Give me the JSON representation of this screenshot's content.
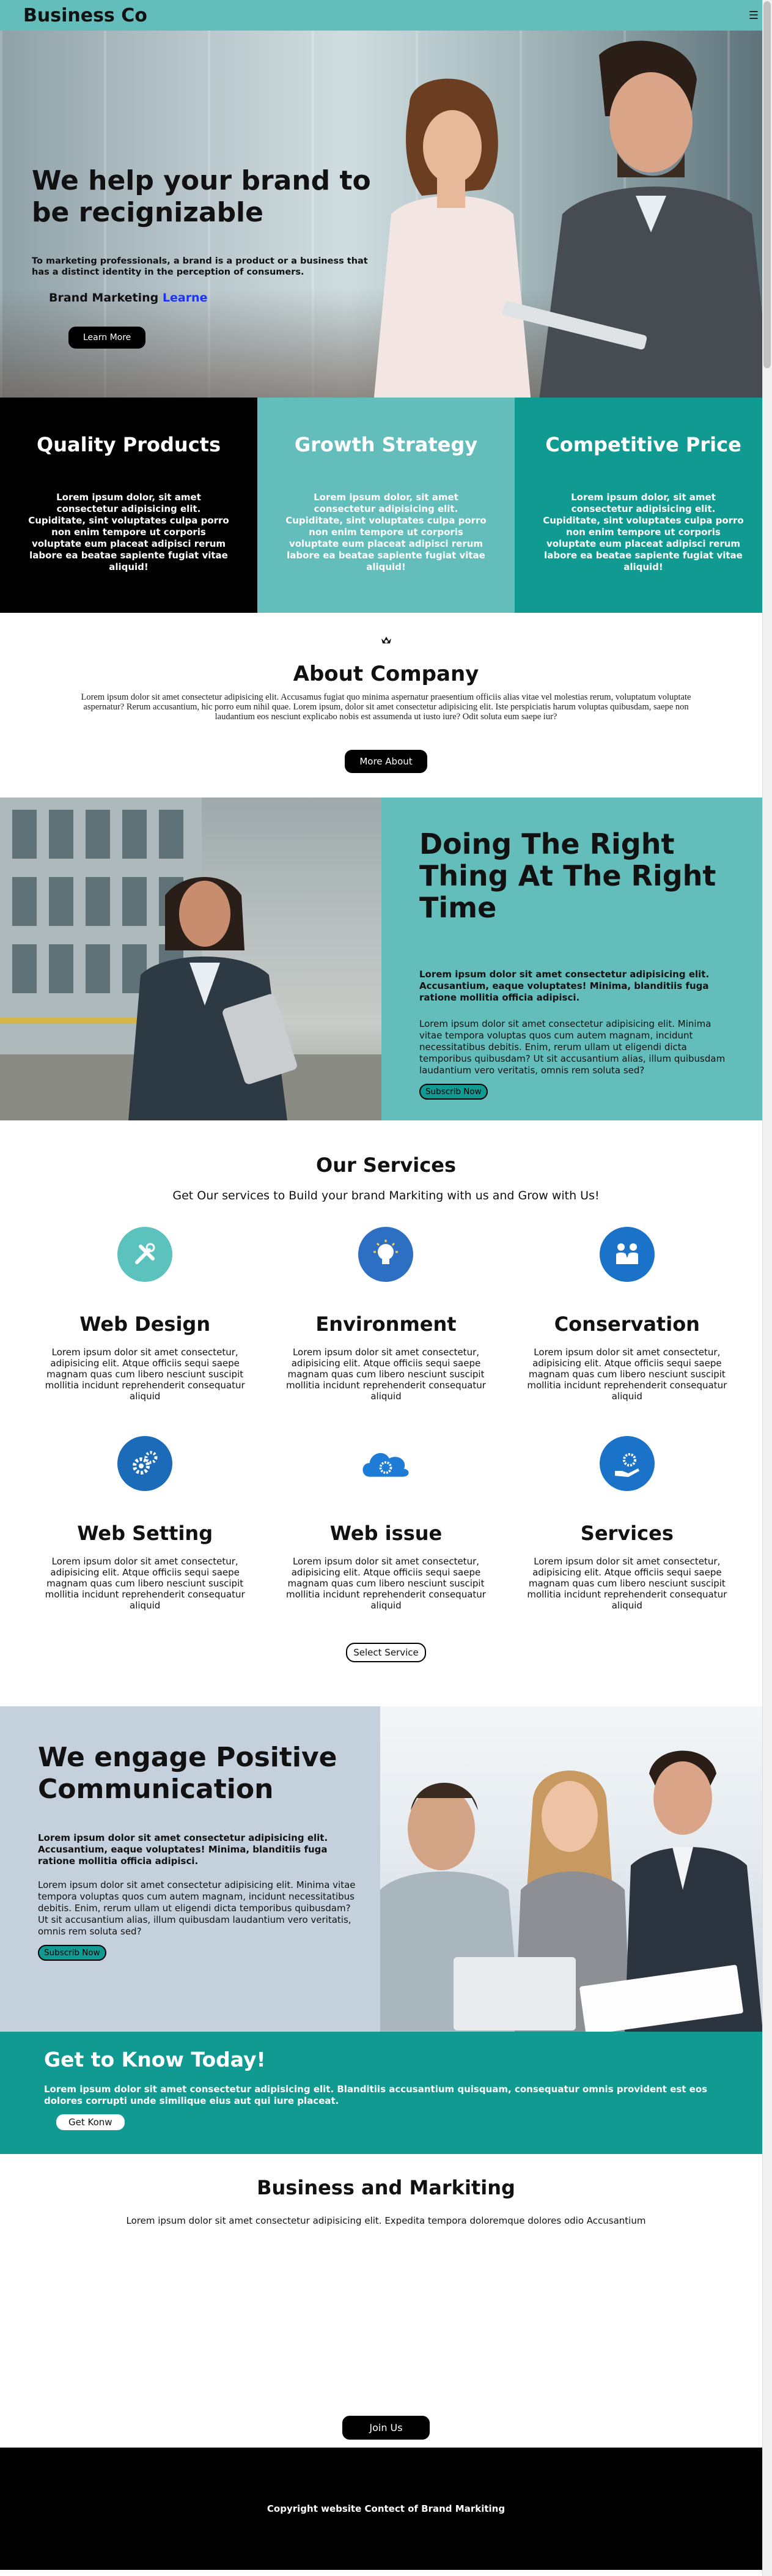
{
  "nav": {
    "brand": "Business Co",
    "menu_icon": "☰"
  },
  "hero": {
    "title": "We help your brand to be recignizable",
    "subtitle": "To marketing professionals, a brand is a product or a business that has a distinct identity in the perception of consumers.",
    "brand_prefix": "Brand Marketing ",
    "brand_accent": "Learne",
    "cta": "Learn More"
  },
  "features": [
    {
      "title": "Quality Products",
      "text": "Lorem ipsum dolor, sit amet consectetur adipisicing elit. Cupiditate, sint voluptates culpa porro non enim tempore ut corporis voluptate eum placeat adipisci rerum labore ea beatae sapiente fugiat vitae aliquid!"
    },
    {
      "title": "Growth Strategy",
      "text": "Lorem ipsum dolor, sit amet consectetur adipisicing elit. Cupiditate, sint voluptates culpa porro non enim tempore ut corporis voluptate eum placeat adipisci rerum labore ea beatae sapiente fugiat vitae aliquid!"
    },
    {
      "title": "Competitive Price",
      "text": "Lorem ipsum dolor, sit amet consectetur adipisicing elit. Cupiditate, sint voluptates culpa porro non enim tempore ut corporis voluptate eum placeat adipisci rerum labore ea beatae sapiente fugiat vitae aliquid!"
    }
  ],
  "about": {
    "title": "About Company",
    "text": "Lorem ipsum dolor sit amet consectetur adipisicing elit. Accusamus fugiat quo minima aspernatur praesentium officiis alias vitae vel molestias rerum, voluptatum voluptate aspernatur? Rerum accusantium, hic porro eum nihil quae. Lorem ipsum, dolor sit amet consectetur adipisicing elit. Iste perspiciatis harum voluptas quibusdam, saepe non laudantium eos nesciunt explicabo nobis est assumenda ut iusto iure? Odit soluta eum saepe iur?",
    "cta": "More About"
  },
  "right_thing": {
    "title": "Doing The Right Thing At The Right Time",
    "lead": "Lorem ipsum dolor sit amet consectetur adipisicing elit. Accusantium, eaque voluptates! Minima, blanditiis fuga ratione mollitia officia adipisci.",
    "body": "Lorem ipsum dolor sit amet consectetur adipisicing elit. Minima vitae tempora voluptas quos cum autem magnam, incidunt necessitatibus debitis. Enim, rerum ullam ut eligendi dicta temporibus quibusdam? Ut sit accusantium alias, illum quibusdam laudantium vero veritatis, omnis rem soluta sed?",
    "cta": "Subscrib Now"
  },
  "services": {
    "title": "Our Services",
    "subtitle": "Get Our services to Build your brand Markiting with us and Grow with Us!",
    "items": [
      {
        "title": "Web Design",
        "text": "Lorem ipsum dolor sit amet consectetur, adipisicing elit. Atque officiis sequi saepe magnam quas cum libero nesciunt suscipit mollitia incidunt reprehenderit consequatur aliquid",
        "icon": "tools-icon",
        "color": "#5cc2bd"
      },
      {
        "title": "Environment",
        "text": "Lorem ipsum dolor sit amet consectetur, adipisicing elit. Atque officiis sequi saepe magnam quas cum libero nesciunt suscipit mollitia incidunt reprehenderit consequatur aliquid",
        "icon": "lightbulb-icon",
        "color": "#2d6fc2"
      },
      {
        "title": "Conservation",
        "text": "Lorem ipsum dolor sit amet consectetur, adipisicing elit. Atque officiis sequi saepe magnam quas cum libero nesciunt suscipit mollitia incidunt reprehenderit consequatur aliquid",
        "icon": "handshake-icon",
        "color": "#1b73c9"
      },
      {
        "title": "Web Setting",
        "text": "Lorem ipsum dolor sit amet consectetur, adipisicing elit. Atque officiis sequi saepe magnam quas cum libero nesciunt suscipit mollitia incidunt reprehenderit consequatur aliquid",
        "icon": "gears-icon",
        "color": "#1b6bb8"
      },
      {
        "title": "Web issue",
        "text": "Lorem ipsum dolor sit amet consectetur, adipisicing elit. Atque officiis sequi saepe magnam quas cum libero nesciunt suscipit mollitia incidunt reprehenderit consequatur aliquid",
        "icon": "cloud-gear-icon",
        "color": "#1e7cd6"
      },
      {
        "title": "Services",
        "text": "Lorem ipsum dolor sit amet consectetur, adipisicing elit. Atque officiis sequi saepe magnam quas cum libero nesciunt suscipit mollitia incidunt reprehenderit consequatur aliquid",
        "icon": "hand-gear-icon",
        "color": "#1b73c9"
      }
    ],
    "cta": "Select Service"
  },
  "engage": {
    "title": "We engage Positive Communication",
    "lead": "Lorem ipsum dolor sit amet consectetur adipisicing elit. Accusantium, eaque voluptates! Minima, blanditiis fuga ratione mollitia officia adipisci.",
    "body": "Lorem ipsum dolor sit amet consectetur adipisicing elit. Minima vitae tempora voluptas quos cum autem magnam, incidunt necessitatibus debitis. Enim, rerum ullam ut eligendi dicta temporibus quibusdam? Ut sit accusantium alias, illum quibusdam laudantium vero veritatis, omnis rem soluta sed?",
    "cta": "Subscrib Now"
  },
  "know": {
    "title": "Get to Know Today!",
    "text": "Lorem ipsum dolor sit amet consectetur adipisicing elit. Blanditiis accusantium quisquam, consequatur omnis provident est eos dolores corrupti unde similique eius aut qui iure placeat.",
    "cta": "Get Konw"
  },
  "business": {
    "title": "Business and Markiting",
    "text": "Lorem ipsum dolor sit amet consectetur adipisicing elit. Expedita tempora doloremque dolores odio Accusantium",
    "cta": "Join Us"
  },
  "footer": {
    "text": "Copyright website Contect of Brand Markiting"
  }
}
